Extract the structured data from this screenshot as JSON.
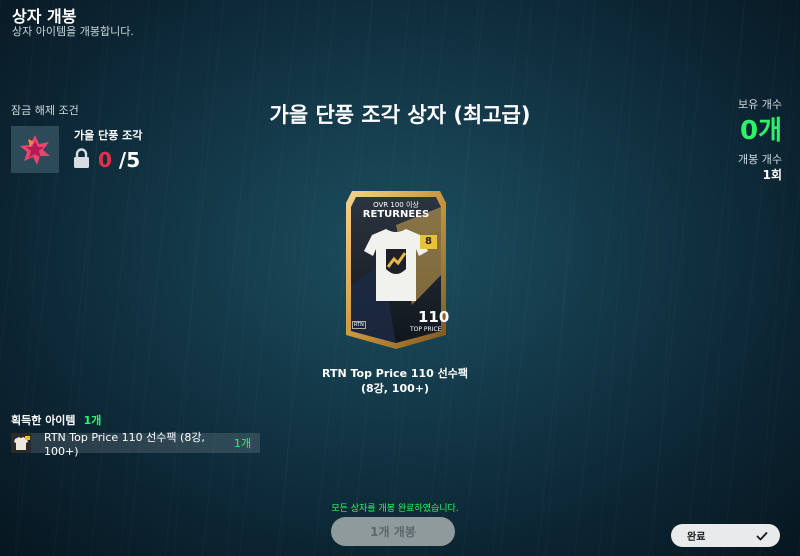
{
  "header": {
    "title": "상자 개봉",
    "subtitle": "상자 아이템을 개봉합니다."
  },
  "unlock": {
    "label": "잠금 해제 조건",
    "item_name": "가을 단풍 조각",
    "current": "0",
    "required": "/5"
  },
  "box": {
    "title": "가을 단풍 조각 상자 (최고급)"
  },
  "stats": {
    "own_label": "보유 개수",
    "own_value": "0개",
    "open_label": "개봉 개수",
    "open_value": "1회"
  },
  "card": {
    "ovr_text": "OVR 100 이상",
    "series": "RETURNEES",
    "grade": "8",
    "price": "110",
    "price_label": "TOP PRICE",
    "badge": "RTN",
    "caption_line1": "RTN Top Price 110 선수팩",
    "caption_line2": "(8강, 100+)"
  },
  "acquired": {
    "label": "획득한 아이템",
    "count": "1개",
    "items": [
      {
        "name": "RTN Top Price 110 선수팩 (8강, 100+)",
        "qty": "1개"
      }
    ]
  },
  "footer": {
    "complete_msg": "모든 상자를 개봉 완료하였습니다.",
    "open_button": "1개 개봉",
    "done_button": "완료"
  },
  "colors": {
    "accent_green": "#2cf56a",
    "alert_red": "#e0324b"
  },
  "icons": {
    "lock": "lock-icon",
    "check": "check-icon",
    "leaf": "maple-leaf-icon"
  }
}
